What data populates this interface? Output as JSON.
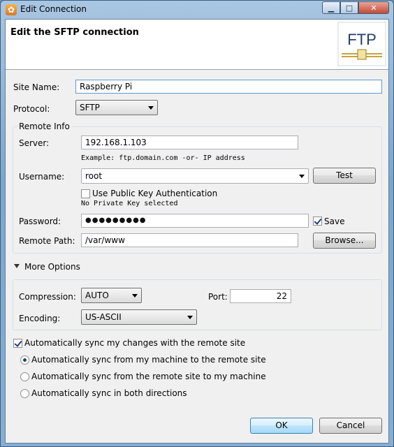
{
  "window": {
    "title": "Edit Connection"
  },
  "header": {
    "title": "Edit the SFTP connection",
    "logo_text": "FTP"
  },
  "site_name": {
    "label": "Site Name:",
    "value": "Raspberry Pi"
  },
  "protocol": {
    "label": "Protocol:",
    "value": "SFTP"
  },
  "remote_info": {
    "title": "Remote Info",
    "server": {
      "label": "Server:",
      "value": "192.168.1.103",
      "example": "Example: ftp.domain.com -or- IP address"
    },
    "username": {
      "label": "Username:",
      "value": "root"
    },
    "test_button": "Test",
    "public_key": {
      "label": "Use Public Key Authentication",
      "checked": false,
      "status": "No Private Key selected"
    },
    "password": {
      "label": "Password:",
      "masked": "●●●●●●●●●",
      "save_label": "Save",
      "save_checked": true
    },
    "remote_path": {
      "label": "Remote Path:",
      "value": "/var/www"
    },
    "browse_button": "Browse..."
  },
  "more_options": {
    "title": "More Options",
    "compression": {
      "label": "Compression:",
      "value": "AUTO"
    },
    "port": {
      "label": "Port:",
      "value": "22"
    },
    "encoding": {
      "label": "Encoding:",
      "value": "US-ASCII"
    }
  },
  "sync": {
    "auto_sync": {
      "label": "Automatically sync my changes with the remote site",
      "checked": true
    },
    "options": [
      {
        "label": "Automatically sync from my machine to the remote site",
        "selected": true
      },
      {
        "label": "Automatically sync from the remote site to my machine",
        "selected": false
      },
      {
        "label": "Automatically sync in both directions",
        "selected": false
      }
    ]
  },
  "buttons": {
    "ok": "OK",
    "cancel": "Cancel"
  }
}
